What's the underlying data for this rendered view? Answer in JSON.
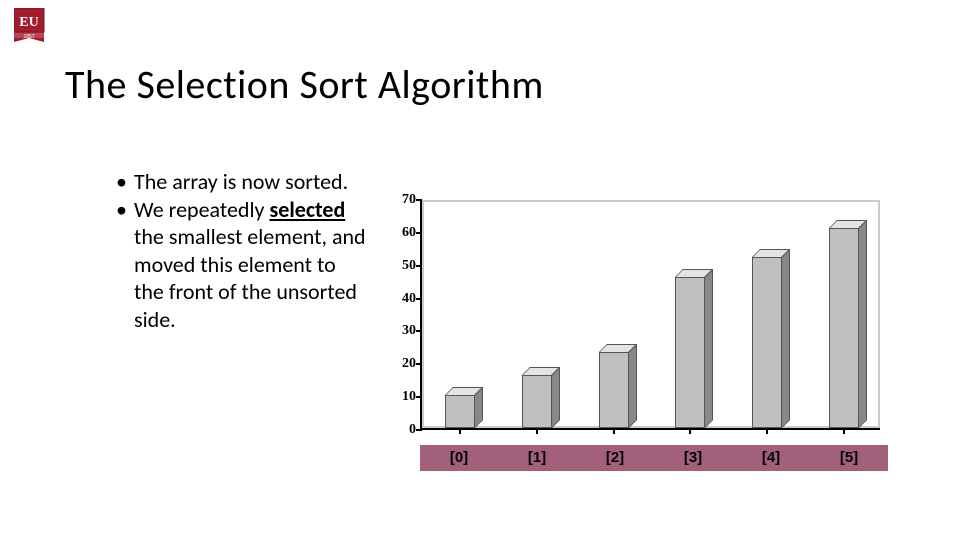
{
  "logo_text": "EU",
  "logo_year": "1857",
  "title": "The Selection Sort Algorithm",
  "bullets": [
    {
      "pre": "The array is now sorted."
    },
    {
      "pre": "We repeatedly ",
      "u": "selected",
      "post": " the smallest element, and moved this element to the front of the unsorted side."
    }
  ],
  "chart_data": {
    "type": "bar",
    "categories": [
      "[0]",
      "[1]",
      "[2]",
      "[3]",
      "[4]",
      "[5]"
    ],
    "values": [
      10,
      16,
      23,
      46,
      52,
      61
    ],
    "yticks": [
      0,
      10,
      20,
      30,
      40,
      50,
      60,
      70
    ],
    "ylim": [
      0,
      70
    ],
    "title": "",
    "xlabel": "",
    "ylabel": ""
  }
}
